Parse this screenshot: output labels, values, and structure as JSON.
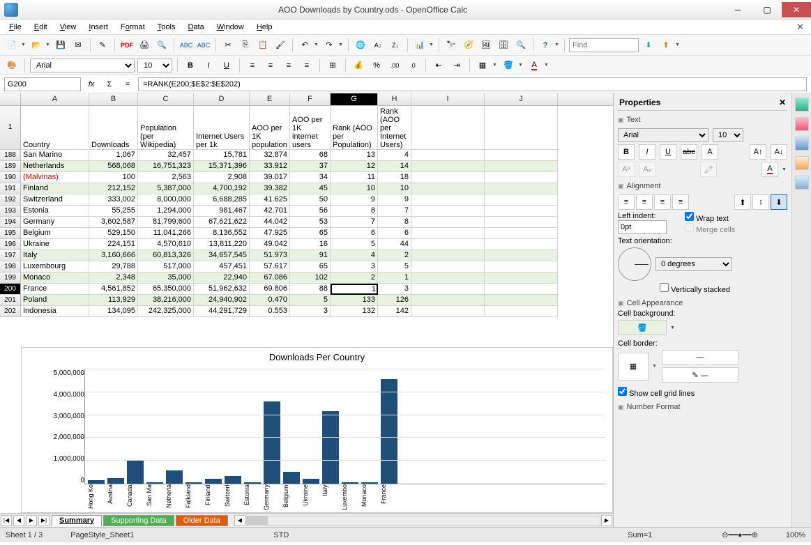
{
  "window": {
    "title": "AOO Downloads by Country.ods - OpenOffice Calc"
  },
  "menu": [
    "File",
    "Edit",
    "View",
    "Insert",
    "Format",
    "Tools",
    "Data",
    "Window",
    "Help"
  ],
  "find_placeholder": "Find",
  "font": {
    "name": "Arial",
    "size": "10"
  },
  "cell_ref": "G200",
  "formula": "=RANK(E200;$E$2:$E$202)",
  "columns": [
    "A",
    "B",
    "C",
    "D",
    "E",
    "F",
    "G",
    "H",
    "I",
    "J"
  ],
  "selected_col": "G",
  "header_row": {
    "num": "1",
    "A": "Country",
    "B": "Downloads",
    "C": "Population (per Wikipedia)",
    "D": "Internet Users per 1k",
    "E": "AOO per 1K population",
    "F": "AOO per 1K internet users",
    "G": "Rank (AOO per Population)",
    "H": "Rank (AOO per Internet Users)"
  },
  "rows": [
    {
      "n": 188,
      "a": "San Marino",
      "b": "1,067",
      "c": "32,457",
      "d": "15,781",
      "e": "32.874",
      "f": "68",
      "g": "13",
      "h": "4"
    },
    {
      "n": 189,
      "a": "Netherlands",
      "b": "568,068",
      "c": "16,751,323",
      "d": "15,371,396",
      "e": "33.912",
      "f": "37",
      "g": "12",
      "h": "14",
      "even": true
    },
    {
      "n": 190,
      "a": "(Malvinas)",
      "b": "100",
      "c": "2,563",
      "d": "2,908",
      "e": "39.017",
      "f": "34",
      "g": "11",
      "h": "18",
      "red": true
    },
    {
      "n": 191,
      "a": "Finland",
      "b": "212,152",
      "c": "5,387,000",
      "d": "4,700,192",
      "e": "39.382",
      "f": "45",
      "g": "10",
      "h": "10",
      "even": true
    },
    {
      "n": 192,
      "a": "Switzerland",
      "b": "333,002",
      "c": "8,000,000",
      "d": "6,688,285",
      "e": "41.625",
      "f": "50",
      "g": "9",
      "h": "9"
    },
    {
      "n": 193,
      "a": "Estonia",
      "b": "55,255",
      "c": "1,294,000",
      "d": "981,467",
      "e": "42.701",
      "f": "56",
      "g": "8",
      "h": "7"
    },
    {
      "n": 194,
      "a": "Germany",
      "b": "3,602,587",
      "c": "81,799,600",
      "d": "67,621,622",
      "e": "44.042",
      "f": "53",
      "g": "7",
      "h": "8"
    },
    {
      "n": 195,
      "a": "Belgium",
      "b": "529,150",
      "c": "11,041,266",
      "d": "8,136,552",
      "e": "47.925",
      "f": "65",
      "g": "6",
      "h": "6"
    },
    {
      "n": 196,
      "a": "Ukraine",
      "b": "224,151",
      "c": "4,570,610",
      "d": "13,811,220",
      "e": "49.042",
      "f": "16",
      "g": "5",
      "h": "44"
    },
    {
      "n": 197,
      "a": "Italy",
      "b": "3,160,666",
      "c": "60,813,326",
      "d": "34,657,545",
      "e": "51.973",
      "f": "91",
      "g": "4",
      "h": "2",
      "even": true
    },
    {
      "n": 198,
      "a": "Luxembourg",
      "b": "29,788",
      "c": "517,000",
      "d": "457,451",
      "e": "57.617",
      "f": "65",
      "g": "3",
      "h": "5"
    },
    {
      "n": 199,
      "a": "Monaco",
      "b": "2,348",
      "c": "35,000",
      "d": "22,940",
      "e": "67.086",
      "f": "102",
      "g": "2",
      "h": "1",
      "even": true
    },
    {
      "n": 200,
      "a": "France",
      "b": "4,561,852",
      "c": "65,350,000",
      "d": "51,962,632",
      "e": "69.806",
      "f": "88",
      "g": "1",
      "h": "3",
      "active": true
    },
    {
      "n": 201,
      "a": "Poland",
      "b": "113,929",
      "c": "38,216,000",
      "d": "24,940,902",
      "e": "0.470",
      "f": "5",
      "g": "133",
      "h": "126",
      "even": true
    },
    {
      "n": 202,
      "a": "Indonesia",
      "b": "134,095",
      "c": "242,325,000",
      "d": "44,291,729",
      "e": "0.553",
      "f": "3",
      "g": "132",
      "h": "142"
    }
  ],
  "chart_data": {
    "type": "bar",
    "title": "Downloads Per Country",
    "ylabel": "",
    "ylim": [
      0,
      5000000
    ],
    "y_ticks": [
      "5,000,000",
      "4,000,000",
      "3,000,000",
      "2,000,000",
      "1,000,000",
      "0"
    ],
    "categories": [
      "Hong Ko",
      "Austria",
      "Canada",
      "San Ma",
      "Netherla",
      "Falkland",
      "Finland",
      "Switzerl",
      "Estonia",
      "Germany",
      "Belgium",
      "Ukraine",
      "Italy",
      "Luxembo",
      "Monaco",
      "France"
    ],
    "values": [
      150000,
      250000,
      1050000,
      1067,
      568068,
      100,
      212152,
      333002,
      55255,
      3602587,
      529150,
      224151,
      3160666,
      29788,
      2348,
      4561852
    ]
  },
  "sheet_tabs": [
    {
      "label": "Summary",
      "active": true
    },
    {
      "label": "Supporting Data",
      "color": "green"
    },
    {
      "label": "Older Data",
      "color": "orange"
    }
  ],
  "statusbar": {
    "sheet": "Sheet 1 / 3",
    "style": "PageStyle_Sheet1",
    "mode": "STD",
    "sum": "Sum=1",
    "zoom": "100%"
  },
  "properties": {
    "title": "Properties",
    "text": {
      "title": "Text",
      "font": "Arial",
      "size": "10"
    },
    "alignment": {
      "title": "Alignment",
      "indent_label": "Left indent:",
      "indent": "0pt",
      "wrap": "Wrap text",
      "merge": "Merge cells",
      "orient_label": "Text orientation:",
      "orient": "0 degrees",
      "vstack": "Vertically stacked"
    },
    "appearance": {
      "title": "Cell Appearance",
      "bg_label": "Cell background:",
      "border_label": "Cell border:",
      "grid": "Show cell grid lines"
    },
    "number": {
      "title": "Number Format"
    }
  }
}
